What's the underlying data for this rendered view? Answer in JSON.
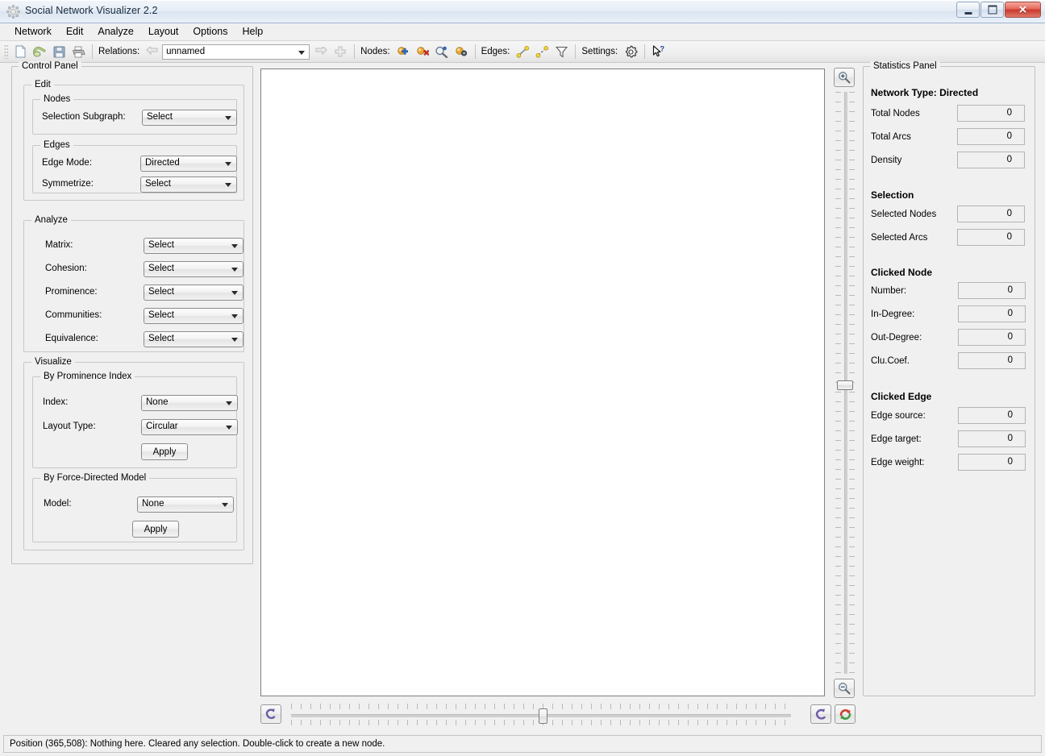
{
  "window": {
    "title": "Social Network Visualizer 2.2",
    "app_icon": "gear-sun-icon",
    "minimize_label": "–",
    "maximize_label": "□",
    "close_label": "✕"
  },
  "menubar": {
    "items": [
      {
        "label": "Network"
      },
      {
        "label": "Edit"
      },
      {
        "label": "Analyze"
      },
      {
        "label": "Layout"
      },
      {
        "label": "Options"
      },
      {
        "label": "Help"
      }
    ]
  },
  "toolbar": {
    "buttons_left": [
      {
        "name": "new-network-icon",
        "title": "New"
      },
      {
        "name": "open-network-icon",
        "title": "Open"
      },
      {
        "name": "save-network-icon",
        "title": "Save"
      },
      {
        "name": "print-network-icon",
        "title": "Print"
      }
    ],
    "relations_label": "Relations:",
    "relation_prev_icon": "previous-relation-icon",
    "relation_value": "unnamed",
    "relation_next_icon": "next-relation-icon",
    "relation_add_icon": "add-relation-icon",
    "nodes_label": "Nodes:",
    "node_add_icon": "add-node-icon",
    "node_remove_icon": "remove-node-icon",
    "node_find_icon": "find-node-icon",
    "node_settings_icon": "node-settings-icon",
    "edges_label": "Edges:",
    "edge_add_icon": "add-edge-icon",
    "edge_remove_icon": "remove-edge-icon",
    "edge_filter_icon": "filter-edge-icon",
    "settings_label": "Settings:",
    "settings_icon": "gear-icon",
    "whats_this_icon": "whats-this-icon"
  },
  "control_panel": {
    "title": "Control Panel",
    "edit": {
      "title": "Edit",
      "nodes": {
        "title": "Nodes",
        "selection_subgraph_label": "Selection Subgraph:",
        "selection_subgraph_value": "Select"
      },
      "edges": {
        "title": "Edges",
        "edge_mode_label": "Edge Mode:",
        "edge_mode_value": "Directed",
        "symmetrize_label": "Symmetrize:",
        "symmetrize_value": "Select"
      }
    },
    "analyze": {
      "title": "Analyze",
      "rows": [
        {
          "label": "Matrix:",
          "value": "Select"
        },
        {
          "label": "Cohesion:",
          "value": "Select"
        },
        {
          "label": "Prominence:",
          "value": "Select"
        },
        {
          "label": "Communities:",
          "value": "Select"
        },
        {
          "label": "Equivalence:",
          "value": "Select"
        }
      ]
    },
    "visualize": {
      "title": "Visualize",
      "prominence": {
        "title": "By Prominence Index",
        "index_label": "Index:",
        "index_value": "None",
        "layout_type_label": "Layout Type:",
        "layout_type_value": "Circular",
        "apply_label": "Apply"
      },
      "force_directed": {
        "title": "By Force-Directed Model",
        "model_label": "Model:",
        "model_value": "None",
        "apply_label": "Apply"
      }
    }
  },
  "statistics_panel": {
    "title": "Statistics Panel",
    "network_type_heading": "Network Type: Directed",
    "network_rows": [
      {
        "label": "Total Nodes",
        "value": "0"
      },
      {
        "label": "Total Arcs",
        "value": "0"
      },
      {
        "label": "Density",
        "value": "0"
      }
    ],
    "selection_heading": "Selection",
    "selection_rows": [
      {
        "label": "Selected Nodes",
        "value": "0"
      },
      {
        "label": "Selected Arcs",
        "value": "0"
      }
    ],
    "clicked_node_heading": "Clicked Node",
    "clicked_node_rows": [
      {
        "label": "Number:",
        "value": "0"
      },
      {
        "label": "In-Degree:",
        "value": "0"
      },
      {
        "label": "Out-Degree:",
        "value": "0"
      },
      {
        "label": "Clu.Coef.",
        "value": "0"
      }
    ],
    "clicked_edge_heading": "Clicked Edge",
    "clicked_edge_rows": [
      {
        "label": "Edge source:",
        "value": "0"
      },
      {
        "label": "Edge target:",
        "value": "0"
      },
      {
        "label": "Edge weight:",
        "value": "0"
      }
    ]
  },
  "zoom_controls": {
    "zoom_in_icon": "zoom-in-icon",
    "zoom_out_icon": "zoom-out-icon",
    "rotate_left_icon": "rotate-left-icon",
    "rotate_right_icon": "rotate-right-icon",
    "reset_view_icon": "reset-view-icon"
  },
  "statusbar": {
    "message": "Position (365,508): Nothing here. Cleared any selection. Double-click to create a new node."
  },
  "colors": {
    "panel_bg": "#f0f0f0",
    "canvas_bg": "#ffffff",
    "title_gradient_top": "#f4f7fb",
    "close_button": "#c8372a",
    "node_blue": "#3a74c4",
    "node_red": "#c0392b",
    "edge_yellow": "#e8c42a",
    "rotate_purple": "#6d5aa8"
  }
}
